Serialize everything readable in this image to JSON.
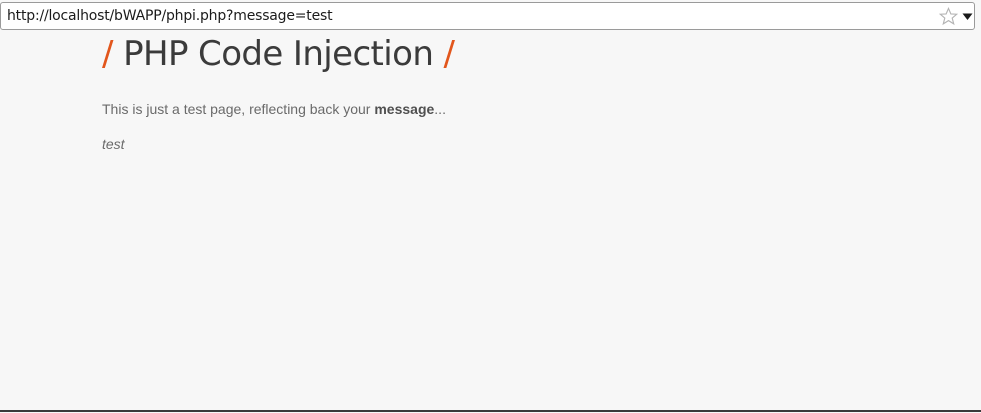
{
  "browser": {
    "url": "http://localhost/bWAPP/phpi.php?message=test",
    "bookmark_icon": "star-outline-icon",
    "dropdown_icon": "dropdown-arrow-icon"
  },
  "page": {
    "title_slash_left": "/",
    "title": "PHP Code Injection",
    "title_slash_right": "/",
    "intro_prefix": "This is just a test page, reflecting back your ",
    "intro_bold": "message",
    "intro_suffix": "...",
    "echoed_message": "test"
  },
  "colors": {
    "accent": "#e2561c",
    "background": "#f7f7f7",
    "title": "#3b3b3b",
    "text": "#6a6a6a"
  }
}
